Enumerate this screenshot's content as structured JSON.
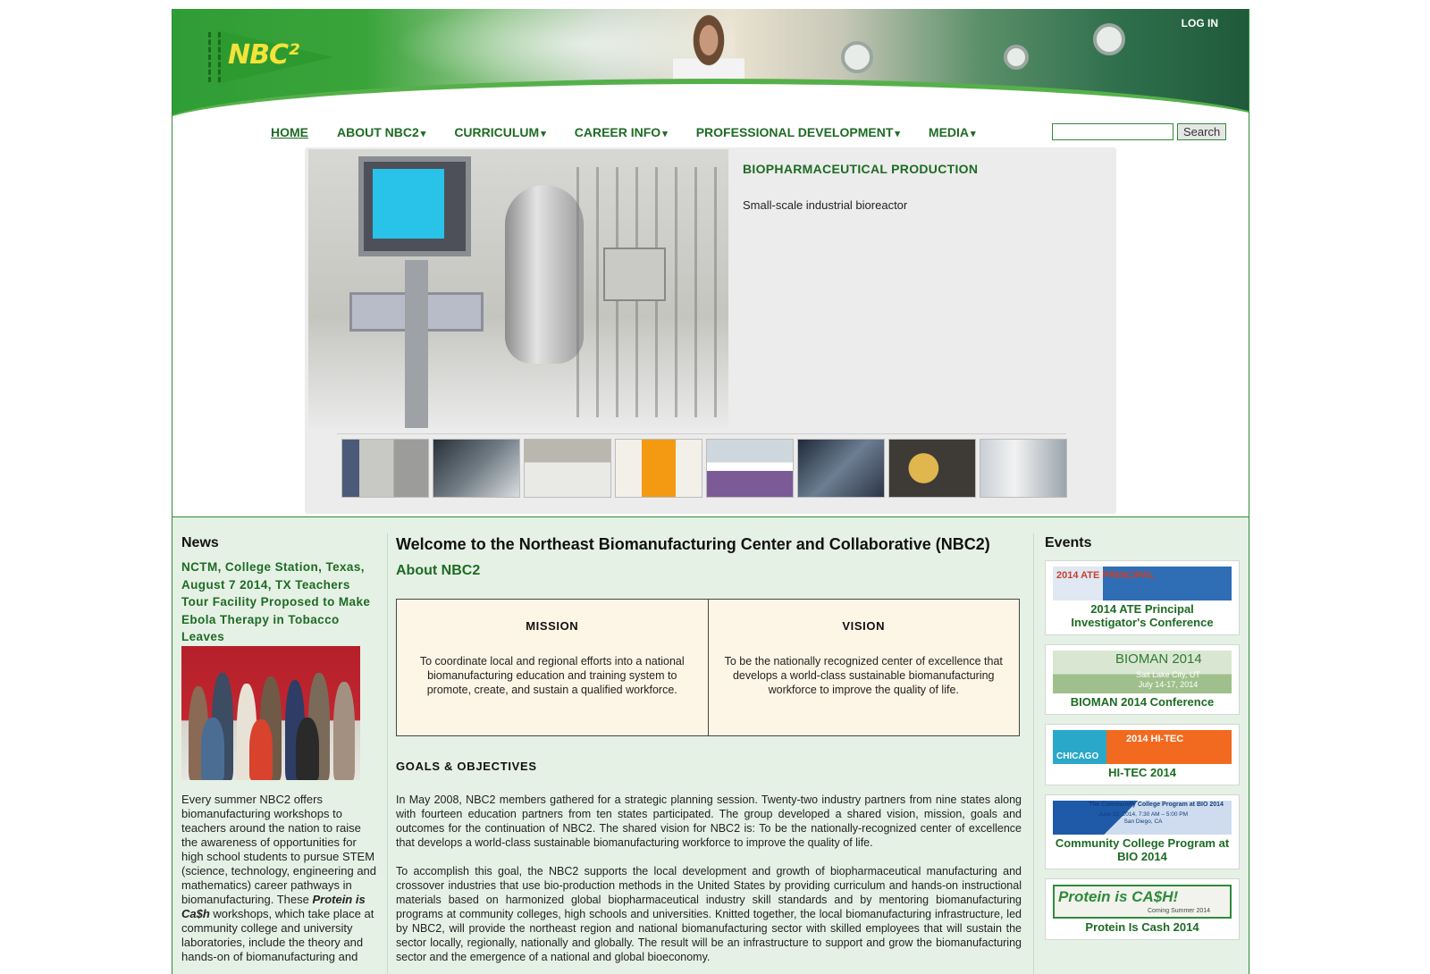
{
  "header": {
    "logo_text": "NBC²",
    "login_label": "LOG IN"
  },
  "nav": {
    "items": [
      {
        "label": "HOME",
        "active": true,
        "dropdown": false
      },
      {
        "label": "ABOUT NBC2",
        "dropdown": true
      },
      {
        "label": "CURRICULUM",
        "dropdown": true
      },
      {
        "label": "CAREER INFO",
        "dropdown": true
      },
      {
        "label": "PROFESSIONAL DEVELOPMENT",
        "dropdown": true
      },
      {
        "label": "MEDIA",
        "dropdown": true
      }
    ],
    "dropdown_glyph": "▾"
  },
  "search": {
    "value": "",
    "button_label": "Search"
  },
  "slideshow": {
    "title": "BIOPHARMACEUTICAL PRODUCTION",
    "caption": "Small-scale industrial bioreactor",
    "thumbnails_count": 8
  },
  "news": {
    "heading": "News",
    "link_text": "NCTM, College Station, Texas, August 7 2014, TX Teachers Tour Facility Proposed to Make Ebola Therapy in Tobacco Leaves",
    "body_start": "Every summer NBC2 offers biomanufacturing workshops to teachers around the nation to raise the awareness of opportunities for high school students to pursue STEM (science, technology, engineering and mathematics) career pathways in biomanufacturing.  These ",
    "body_emph": "Protein is Ca$h",
    "body_end": " workshops, which take place at community college and university laboratories, include the theory and hands-on of biomanufacturing and"
  },
  "main": {
    "title": "Welcome to the Northeast Biomanufacturing Center and Collaborative (NBC2)",
    "about_heading": "About NBC2",
    "mission": {
      "heading": "MISSION",
      "text": "To coordinate local and regional efforts into a national biomanufacturing education and training system to promote, create, and sustain a qualified workforce."
    },
    "vision": {
      "heading": "VISION",
      "text": "To be the nationally recognized center of excellence that develops a world-class sustainable biomanufacturing workforce to improve the quality of life."
    },
    "goals_heading": "GOALS & OBJECTIVES",
    "paragraphs": [
      "In May 2008, NBC2 members gathered for a strategic planning session. Twenty-two industry partners from nine states along with fourteen education partners from ten states participated. The group developed a shared vision, mission, goals and outcomes for the continuation of NBC2. The shared vision for NBC2 is: To be the nationally-recognized center of excellence that develops a world-class sustainable biomanufacturing workforce to improve the quality of life.",
      "To accomplish this goal, the NBC2 supports the local development and growth of biopharmaceutical manufacturing and crossover industries that use bio-production methods in the United States by providing curriculum and hands-on instructional materials based on harmonized global biopharmaceutical industry skill standards and by mentoring biomanufacturing programs at community colleges, high schools and universities. Knitted together, the local biomanufacturing infrastructure, led by NBC2, will provide the northeast region and national biomanufacturing sector with skilled employees that will sustain the sector locally, regionally, nationally and globally. The result will be an infrastructure to support and grow the biomanufacturing sector and the emergence of a national and global bioeconomy."
    ]
  },
  "events": {
    "heading": "Events",
    "items": [
      {
        "label": "2014 ATE Principal Investigator's Conference",
        "banner_text": "2014 ATE PRINCIPAL"
      },
      {
        "label": "BIOMAN 2014 Conference",
        "banner_text": "BIOMAN 2014",
        "banner_sub": "Salt Lake City, UT  July 14-17, 2014"
      },
      {
        "label": "HI-TEC 2014",
        "banner_text": "2014 HI-TEC",
        "banner_sub": "CHICAGO"
      },
      {
        "label": "Community College Program at BIO 2014",
        "banner_text": "The Community College Program at BIO 2014",
        "banner_sub": "June 23, 2014, 7:30 AM – 5:00 PM  San Diego, CA"
      },
      {
        "label": "Protein Is Cash 2014",
        "banner_text": "Protein is CA$H!",
        "banner_sub": "Coming Summer 2014"
      }
    ]
  }
}
